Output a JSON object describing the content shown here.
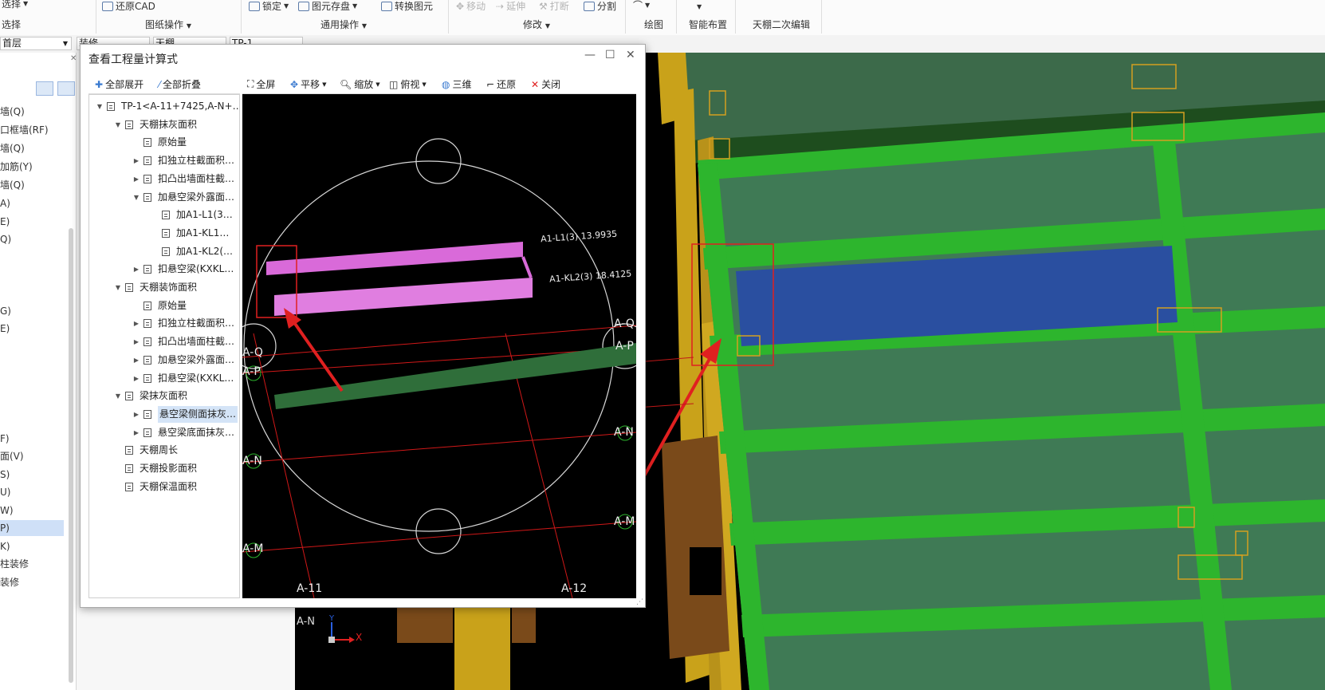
{
  "ribbon": {
    "select_top": "选择",
    "select_bottom": "选择",
    "restore_cad": "还原CAD",
    "drawing_ops": "图纸操作",
    "lock": "锁定",
    "element_store": "图元存盘",
    "convert_element": "转换图元",
    "common_ops": "通用操作",
    "move": "移动",
    "extend": "延伸",
    "break": "打断",
    "split": "分割",
    "modify": "修改",
    "draw": "绘图",
    "smart_layout": "智能布置",
    "ceiling_edit": "天棚二次编辑"
  },
  "floorbar": {
    "floor": "首层",
    "f2": "装修",
    "f3": "天棚",
    "f4": "TP-1"
  },
  "leftnav": {
    "items": [
      "墙(Q)",
      "口框墙(RF)",
      "墙(Q)",
      "加筋(Y)",
      "墙(Q)",
      "A)",
      "E)",
      "Q)",
      "G)",
      "E)",
      "F)",
      "面(V)",
      "S)",
      "U)",
      "W)",
      "P)",
      "K)",
      "柱装修",
      "装修"
    ]
  },
  "dialog": {
    "title": "查看工程量计算式",
    "expand_all": "全部展开",
    "collapse_all": "全部折叠",
    "view_toolbar": {
      "fullscreen": "全屏",
      "pan": "平移",
      "zoom": "缩放",
      "top_view": "俯视",
      "three_d": "三维",
      "restore": "还原",
      "close": "关闭"
    },
    "tree": [
      {
        "label": "TP-1<A-11+7425,A-N+…",
        "level": 0,
        "toggle": "open"
      },
      {
        "label": "天棚抹灰面积",
        "level": 1,
        "toggle": "open"
      },
      {
        "label": "原始量",
        "level": 2,
        "toggle": "none"
      },
      {
        "label": "扣独立柱截面积…",
        "level": 2,
        "toggle": "closed"
      },
      {
        "label": "扣凸出墙面柱截…",
        "level": 2,
        "toggle": "closed"
      },
      {
        "label": "加悬空梁外露面…",
        "level": 2,
        "toggle": "open"
      },
      {
        "label": "加A1-L1(3…",
        "level": 3,
        "toggle": "none"
      },
      {
        "label": "加A1-KL1…",
        "level": 3,
        "toggle": "none"
      },
      {
        "label": "加A1-KL2(…",
        "level": 3,
        "toggle": "none"
      },
      {
        "label": "扣悬空梁(KXKL…",
        "level": 2,
        "toggle": "closed"
      },
      {
        "label": "天棚装饰面积",
        "level": 1,
        "toggle": "open"
      },
      {
        "label": "原始量",
        "level": 2,
        "toggle": "none"
      },
      {
        "label": "扣独立柱截面积…",
        "level": 2,
        "toggle": "closed"
      },
      {
        "label": "扣凸出墙面柱截…",
        "level": 2,
        "toggle": "closed"
      },
      {
        "label": "加悬空梁外露面…",
        "level": 2,
        "toggle": "closed"
      },
      {
        "label": "扣悬空梁(KXKL…",
        "level": 2,
        "toggle": "closed"
      },
      {
        "label": "梁抹灰面积",
        "level": 1,
        "toggle": "open"
      },
      {
        "label": "悬空梁侧面抹灰…",
        "level": 2,
        "toggle": "closed",
        "selected": true
      },
      {
        "label": "悬空梁底面抹灰…",
        "level": 2,
        "toggle": "closed"
      },
      {
        "label": "天棚周长",
        "level": 1,
        "toggle": "none"
      },
      {
        "label": "天棚投影面积",
        "level": 1,
        "toggle": "none"
      },
      {
        "label": "天棚保温面积",
        "level": 1,
        "toggle": "none"
      }
    ],
    "canvas": {
      "beam1_label": "A1-L1(3) 13.9935",
      "beam2_label": "A1-KL2(3) 18.4125",
      "axis_labels": [
        "A-Q",
        "A-P",
        "A-N",
        "A-M",
        "A-11",
        "A-12"
      ]
    }
  },
  "viewport": {
    "axis_label": "A-N",
    "x_axis": "X",
    "y_axis": "Y"
  },
  "colors": {
    "ribbon_bg": "#fbfbfb",
    "beam_magenta": "#d96ad9",
    "slab_green": "#2db52d",
    "slab_fill": "#3f7a55",
    "highlight_blue": "#2a4fa0",
    "column_yellow": "#c9a21a",
    "annotation_red": "#e02020"
  }
}
